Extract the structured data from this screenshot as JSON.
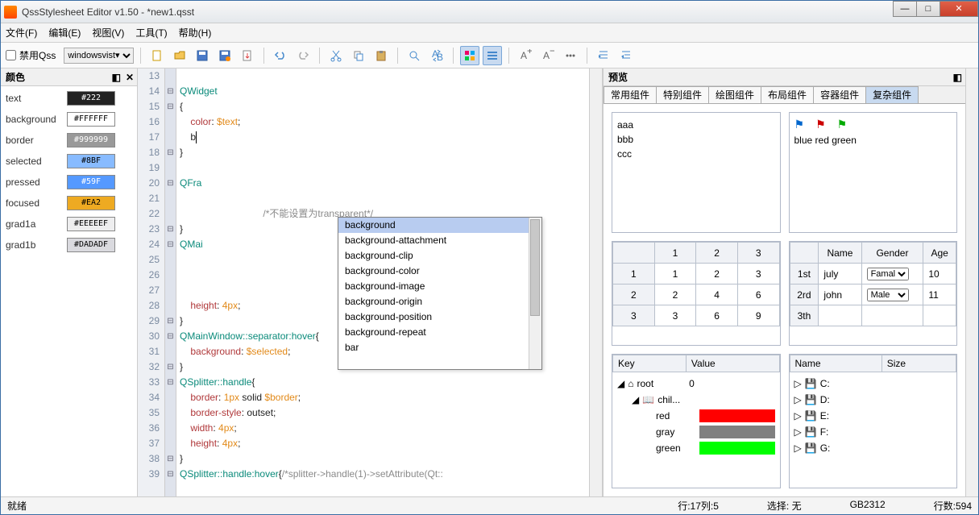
{
  "title": "QssStylesheet Editor v1.50 - *new1.qsst",
  "menus": {
    "file": "文件(F)",
    "edit": "编辑(E)",
    "view": "视图(V)",
    "tools": "工具(T)",
    "help": "帮助(H)"
  },
  "toolbar": {
    "disable_qss": "禁用Qss",
    "theme": "windowsvist▾"
  },
  "color_panel": {
    "title": "颜色",
    "rows": [
      {
        "name": "text",
        "value": "#222",
        "bg": "#222222",
        "fg": "#fff"
      },
      {
        "name": "background",
        "value": "#FFFFFF",
        "bg": "#ffffff",
        "fg": "#000"
      },
      {
        "name": "border",
        "value": "#999999",
        "bg": "#999999",
        "fg": "#fff"
      },
      {
        "name": "selected",
        "value": "#8BF",
        "bg": "#88bbff",
        "fg": "#000"
      },
      {
        "name": "pressed",
        "value": "#59F",
        "bg": "#5599ff",
        "fg": "#fff"
      },
      {
        "name": "focused",
        "value": "#EA2",
        "bg": "#eeaa22",
        "fg": "#000"
      },
      {
        "name": "grad1a",
        "value": "#EEEEEF",
        "bg": "#eeeeef",
        "fg": "#000"
      },
      {
        "name": "grad1b",
        "value": "#DADADF",
        "bg": "#dadadf",
        "fg": "#000"
      }
    ]
  },
  "editor": {
    "first_line": 13,
    "lines": [
      "",
      "<span class='sel'>QWidget</span>",
      "{",
      "    <span class='prop'>color</span>: <span class='var'>$text</span>;",
      "    b<span class='cur'></span>",
      "}",
      "",
      "<span class='sel'>QFra</span>",
      "",
      "                               <span class='cmt'>/*不能设置为transparent*/</span>",
      "}",
      "<span class='sel'>QMai</span>",
      "",
      "",
      "",
      "    <span class='prop'>height</span>: <span class='var'>4px</span>;",
      "}",
      "<span class='sel'>QMainWindow::separator:hover</span>{",
      "    <span class='prop'>background</span>: <span class='var'>$selected</span>;",
      "}",
      "<span class='sel'>QSplitter::handle</span>{",
      "    <span class='prop'>border</span>: <span class='var'>1px</span> solid <span class='var'>$border</span>;",
      "    <span class='prop'>border-style</span>: outset;",
      "    <span class='prop'>width</span>: <span class='var'>4px</span>;",
      "    <span class='prop'>height</span>: <span class='var'>4px</span>;",
      "}",
      "<span class='sel'>QSplitter::handle:hover</span>{<span class='cmt'>/*splitter->handle(1)->setAttribute(Qt::</span>"
    ]
  },
  "autocomplete": [
    "background",
    "background-attachment",
    "background-clip",
    "background-color",
    "background-image",
    "background-origin",
    "background-position",
    "background-repeat",
    "bar"
  ],
  "preview": {
    "title": "预览",
    "tabs": [
      "常用组件",
      "特别组件",
      "绘图组件",
      "布局组件",
      "容器组件",
      "复杂组件"
    ],
    "active_tab": 5,
    "listbox": [
      "aaa",
      "bbb",
      "ccc"
    ],
    "flags_text": "blue  red  green",
    "grid": {
      "cols": [
        "",
        "1",
        "2",
        "3"
      ],
      "rows": [
        [
          "1",
          "1",
          "2",
          "3"
        ],
        [
          "2",
          "2",
          "4",
          "6"
        ],
        [
          "3",
          "3",
          "6",
          "9"
        ]
      ]
    },
    "people": {
      "cols": [
        "",
        "Name",
        "Gender",
        "Age"
      ],
      "rows": [
        [
          "1st",
          "july",
          "Famale",
          "10"
        ],
        [
          "2rd",
          "john",
          "Male",
          "11"
        ],
        [
          "3th",
          "",
          "",
          ""
        ]
      ]
    },
    "kv": {
      "headers": [
        "Key",
        "Value"
      ],
      "root": "root",
      "root_val": "0",
      "child": "chil...",
      "colors": [
        [
          "red",
          "#ff0000"
        ],
        [
          "gray",
          "#808080"
        ],
        [
          "green",
          "#00ff00"
        ]
      ]
    },
    "drives": {
      "headers": [
        "Name",
        "Size"
      ],
      "items": [
        "C:",
        "D:",
        "E:",
        "F:",
        "G:"
      ]
    }
  },
  "status": {
    "ready": "就绪",
    "pos": "行:17列:5",
    "sel": "选择: 无",
    "enc": "GB2312",
    "lines": "行数:594"
  }
}
